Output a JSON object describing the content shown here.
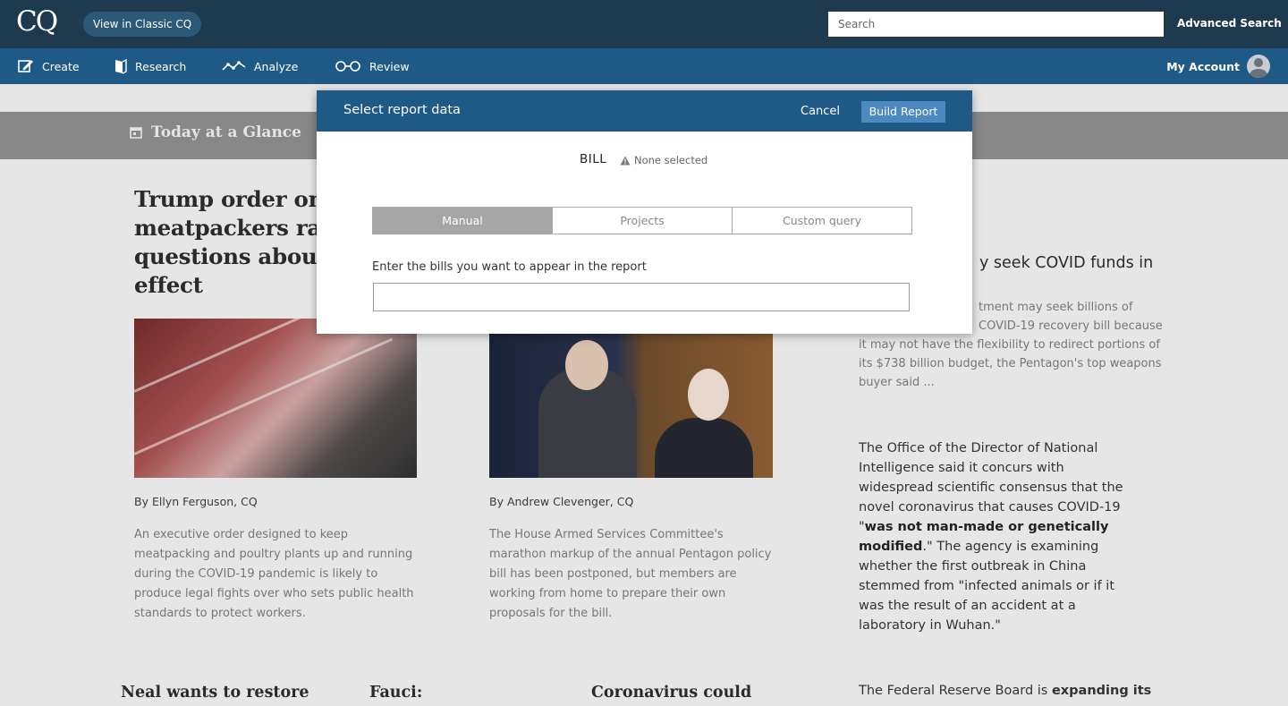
{
  "header": {
    "logo": "CQ",
    "classic_button": "View in Classic CQ",
    "search_placeholder": "Search",
    "advanced_search": "Advanced Search"
  },
  "nav": {
    "items": [
      {
        "label": "Create",
        "icon": "pencil-square-icon"
      },
      {
        "label": "Research",
        "icon": "book-icon"
      },
      {
        "label": "Analyze",
        "icon": "line-chart-icon"
      },
      {
        "label": "Review",
        "icon": "glasses-icon"
      }
    ],
    "account": "My Account"
  },
  "glance": {
    "title": "Today at a Glance",
    "separator": "|"
  },
  "articles": {
    "main_headline": "Trump order on meatpackers raises questions about effect",
    "story1": {
      "byline": "By Ellyn Ferguson, CQ",
      "blurb": "An executive order designed to keep meatpacking and poultry plants up and running during the COVID-19 pandemic is likely to produce legal fights over who sets public health standards to protect workers."
    },
    "story2": {
      "byline": "By Andrew Clevenger, CQ",
      "blurb": "The House Armed Services Committee's marathon markup of the annual Pentagon policy bill has been postponed, but members are working from home to prepare their own proposals for the bill."
    },
    "right_headline_visible": "y seek COVID funds in",
    "right_blurb_line1": "tment may seek billions of",
    "right_blurb_line2": "COVID-19 recovery bill because",
    "right_blurb_rest": "it may not have the flexibility to redirect portions of its $738 billion budget, the Pentagon's top weapons buyer said ...",
    "odni": {
      "part1": "The Office of the Director of National Intelligence said it concurs with widespread scientific consensus that the novel coronavirus that causes COVID-19 \"",
      "bold": "was not man-made or genetically modified",
      "part2": ".\" The agency is examining whether the first outbreak in China stemmed from \"infected animals or if it was the result of an accident at a laboratory in Wuhan.\""
    },
    "bottom": [
      "Neal wants to restore",
      "Fauci:",
      "Coronavirus could"
    ],
    "fed_text": "The Federal Reserve Board is ",
    "fed_bold": "expanding its"
  },
  "modal": {
    "title": "Select report data",
    "cancel": "Cancel",
    "build": "Build Report",
    "bill_label": "BILL",
    "bill_status": "None selected",
    "tabs": [
      "Manual",
      "Projects",
      "Custom query"
    ],
    "active_tab": "Manual",
    "input_label": "Enter the bills you want to appear in the report",
    "input_value": ""
  }
}
